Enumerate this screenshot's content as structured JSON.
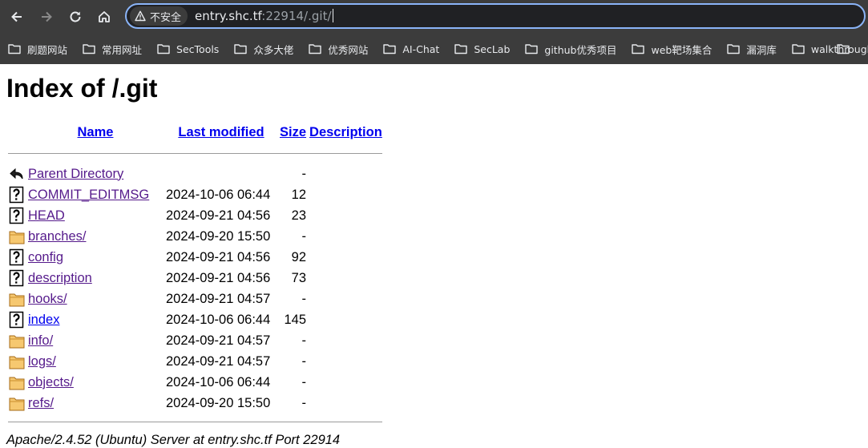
{
  "browser": {
    "security_label": "不安全",
    "url_host": "entry.shc.tf",
    "url_rest": ":22914/.git/",
    "icons": [
      "back-icon",
      "forward-icon",
      "reload-icon",
      "home-icon",
      "warning-triangle-icon",
      "folder-icon"
    ],
    "bookmarks": [
      "刷题网站",
      "常用网址",
      "SecTools",
      "众多大佬",
      "优秀网站",
      "AI-Chat",
      "SecLab",
      "github优秀项目",
      "web靶场集合",
      "漏洞库",
      "walkthrough"
    ]
  },
  "page": {
    "title": "Index of /.git",
    "columns": {
      "name": "Name",
      "last_modified": "Last modified",
      "size": "Size",
      "description": "Description"
    },
    "rows": [
      {
        "icon": "back",
        "name": "Parent Directory",
        "date": "",
        "size": "-",
        "visited": true
      },
      {
        "icon": "unknown",
        "name": "COMMIT_EDITMSG",
        "date": "2024-10-06 06:44",
        "size": "12",
        "visited": true
      },
      {
        "icon": "unknown",
        "name": "HEAD",
        "date": "2024-09-21 04:56",
        "size": "23",
        "visited": true
      },
      {
        "icon": "folder",
        "name": "branches/",
        "date": "2024-09-20 15:50",
        "size": "-",
        "visited": true
      },
      {
        "icon": "unknown",
        "name": "config",
        "date": "2024-09-21 04:56",
        "size": "92",
        "visited": true
      },
      {
        "icon": "unknown",
        "name": "description",
        "date": "2024-09-21 04:56",
        "size": "73",
        "visited": true
      },
      {
        "icon": "folder",
        "name": "hooks/",
        "date": "2024-09-21 04:57",
        "size": "-",
        "visited": true
      },
      {
        "icon": "unknown",
        "name": "index",
        "date": "2024-10-06 06:44",
        "size": "145",
        "visited": false
      },
      {
        "icon": "folder",
        "name": "info/",
        "date": "2024-09-21 04:57",
        "size": "-",
        "visited": true
      },
      {
        "icon": "folder",
        "name": "logs/",
        "date": "2024-09-21 04:57",
        "size": "-",
        "visited": true
      },
      {
        "icon": "folder",
        "name": "objects/",
        "date": "2024-10-06 06:44",
        "size": "-",
        "visited": true
      },
      {
        "icon": "folder",
        "name": "refs/",
        "date": "2024-09-20 15:50",
        "size": "-",
        "visited": true
      }
    ],
    "footer": "Apache/2.4.52 (Ubuntu) Server at entry.shc.tf Port 22914"
  },
  "colors": {
    "chrome_bg": "#3c3c3c",
    "omnibox_border": "#8ab4f8",
    "link": "#0000ee",
    "visited_link": "#551a8b"
  }
}
